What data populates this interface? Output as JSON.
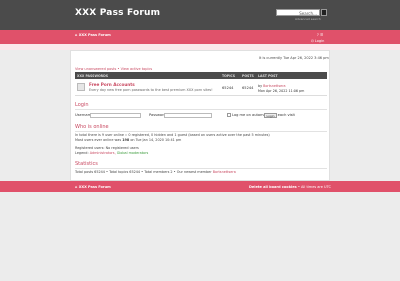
{
  "header": {
    "site_title": "XXX Pass Forum",
    "search_placeholder": "Search…",
    "advanced_search": "Advanced search"
  },
  "nav": {
    "home": "⌂ XXX Pass Forum",
    "icons": "? ☰",
    "login": "⏻ Login"
  },
  "main": {
    "time": "It is currently Tue Apr 26, 2022 3:46 pm",
    "links": "View unanswered posts • View active topics",
    "forum_header": {
      "name": "XXX PASSWORDS",
      "topics": "TOPICS",
      "posts": "POSTS",
      "last_post": "LAST POST"
    },
    "forum": {
      "title": "Free Porn Accounts",
      "desc": "Every day new free porn passwords to the best premium XXX porn sites!",
      "topics": "65244",
      "posts": "65244",
      "last_by_prefix": "by",
      "last_by_user": "Bortsnettsera",
      "last_date": "Mon Apr 26, 2022 11:06 pm"
    },
    "login": {
      "title": "Login",
      "username": "Username:",
      "password": "Password:",
      "remember": "Log me on automatically each visit",
      "button": "Login"
    },
    "who": {
      "title": "Who is online",
      "line1": "In total there is 9 user online :: 0 registered, 0 hidden and 1 guest (based on users active over the past 5 minutes)",
      "line2_prefix": "Most users ever online was",
      "line2_num": "198",
      "line2_suffix": "on Tue Jan 14, 2020 10:41 pm",
      "registered": "Registered users: No registered users",
      "legend_prefix": "Legend:",
      "legend_admins": "Administrators,",
      "legend_mods": "Global moderators"
    },
    "stats": {
      "title": "Statistics",
      "line": "Total posts 65244 • Total topics 65244 • Total members 2 • Our newest member ",
      "newest": "Bortsnettsera"
    }
  },
  "footer": {
    "home": "⌂ XXX Pass Forum",
    "delete": "Delete all board cookies",
    "times": "• All times are UTC"
  }
}
